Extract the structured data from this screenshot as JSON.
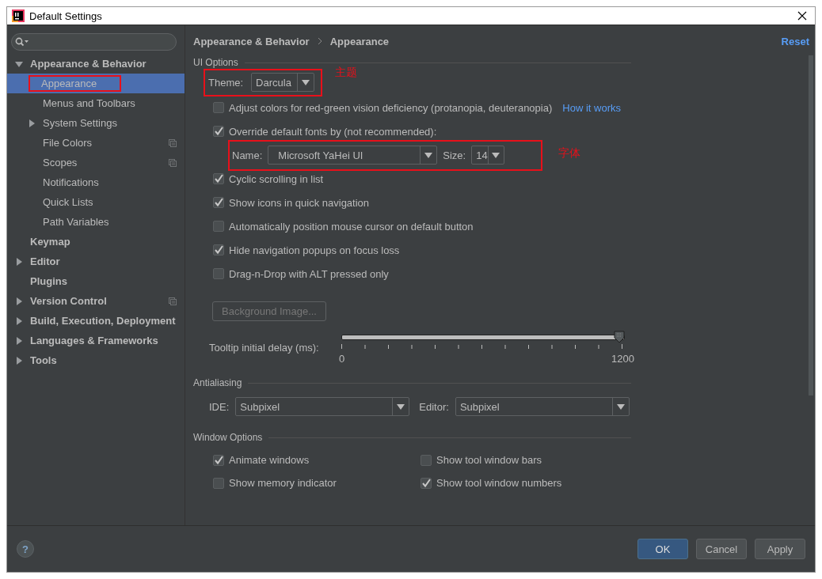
{
  "window": {
    "title": "Default Settings"
  },
  "sidebar": {
    "items": [
      {
        "label": "Appearance & Behavior",
        "expanded": true,
        "selected": false,
        "per_project": false,
        "children": [
          {
            "label": "Appearance",
            "selected": true,
            "per_project": false,
            "highlighted": true
          },
          {
            "label": "Menus and Toolbars",
            "selected": false,
            "per_project": false
          },
          {
            "label": "System Settings",
            "expanded": false,
            "selected": false,
            "per_project": false
          },
          {
            "label": "File Colors",
            "selected": false,
            "per_project": true
          },
          {
            "label": "Scopes",
            "selected": false,
            "per_project": true
          },
          {
            "label": "Notifications",
            "selected": false,
            "per_project": false
          },
          {
            "label": "Quick Lists",
            "selected": false,
            "per_project": false
          },
          {
            "label": "Path Variables",
            "selected": false,
            "per_project": false
          }
        ]
      },
      {
        "label": "Keymap",
        "selected": false,
        "per_project": false
      },
      {
        "label": "Editor",
        "expanded": false,
        "selected": false,
        "per_project": false
      },
      {
        "label": "Plugins",
        "selected": false,
        "per_project": false
      },
      {
        "label": "Version Control",
        "expanded": false,
        "selected": false,
        "per_project": true
      },
      {
        "label": "Build, Execution, Deployment",
        "expanded": false,
        "selected": false,
        "per_project": false
      },
      {
        "label": "Languages & Frameworks",
        "expanded": false,
        "selected": false,
        "per_project": false
      },
      {
        "label": "Tools",
        "expanded": false,
        "selected": false,
        "per_project": false
      }
    ]
  },
  "breadcrumb": [
    "Appearance & Behavior",
    "Appearance"
  ],
  "reset_link": "Reset",
  "ui_options": {
    "title": "UI Options",
    "theme": {
      "label": "Theme:",
      "value": "Darcula",
      "highlighted": true,
      "annotation": "主题"
    },
    "rows": [
      {
        "kind": "checkbox",
        "label": "Adjust colors for red-green vision deficiency (protanopia, deuteranopia)",
        "checked": false,
        "link": "How it works"
      },
      {
        "kind": "checkbox",
        "label": "Override default fonts by (not recommended):",
        "checked": true
      },
      {
        "kind": "font",
        "name_label": "Name:",
        "name_value": "Microsoft YaHei UI",
        "size_label": "Size:",
        "size_value": "14",
        "highlighted": true,
        "annotation": "字体"
      },
      {
        "kind": "checkbox",
        "label": "Cyclic scrolling in list",
        "checked": true
      },
      {
        "kind": "checkbox",
        "label": "Show icons in quick navigation",
        "checked": true
      },
      {
        "kind": "checkbox",
        "label": "Automatically position mouse cursor on default button",
        "checked": false
      },
      {
        "kind": "checkbox",
        "label": "Hide navigation popups on focus loss",
        "checked": true
      },
      {
        "kind": "checkbox",
        "label": "Drag-n-Drop with ALT pressed only",
        "checked": false
      }
    ],
    "background_button": {
      "label": "Background Image...",
      "disabled": true
    },
    "slider": {
      "label": "Tooltip initial delay (ms):",
      "level": 1.0,
      "min_label": "0",
      "max_label": "1200"
    }
  },
  "antialiasing": {
    "title": "Antialiasing",
    "ide_label": "IDE:",
    "ide_value": "Subpixel",
    "editor_label": "Editor:",
    "editor_value": "Subpixel"
  },
  "window_options": {
    "title": "Window Options",
    "items": [
      {
        "label": "Animate windows",
        "checked": true
      },
      {
        "label": "Show tool window bars",
        "checked": false
      },
      {
        "label": "Show memory indicator",
        "checked": false
      },
      {
        "label": "Show tool window numbers",
        "checked": true
      }
    ]
  },
  "footer": {
    "help": "?",
    "buttons": [
      {
        "label": "OK",
        "default": true
      },
      {
        "label": "Cancel",
        "default": false
      },
      {
        "label": "Apply",
        "default": false
      }
    ]
  }
}
